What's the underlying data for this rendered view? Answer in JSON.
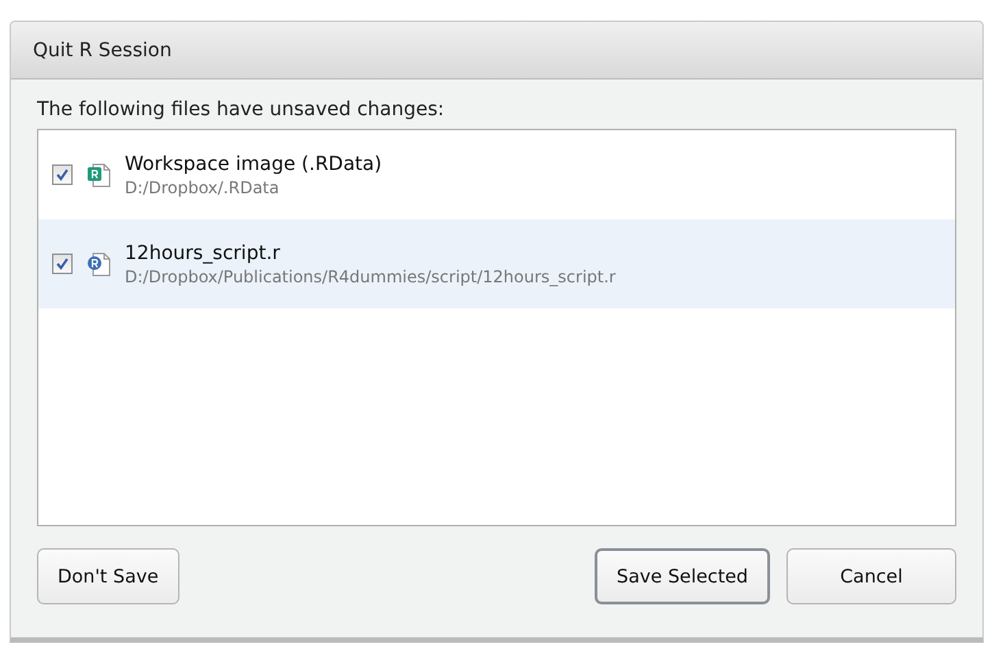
{
  "window": {
    "title": "Quit R Session"
  },
  "message": "The following files have unsaved changes:",
  "files": [
    {
      "kind": "workspace",
      "name": "Workspace image (.RData)",
      "path": "D:/Dropbox/.RData",
      "checked": true,
      "selected": false
    },
    {
      "kind": "script",
      "name": "12hours_script.r",
      "path": "D:/Dropbox/Publications/R4dummies/script/12hours_script.r",
      "checked": true,
      "selected": true
    }
  ],
  "buttons": [
    {
      "label": "Don't Save",
      "default": false
    },
    {
      "label": "Save Selected",
      "default": true
    },
    {
      "label": "Cancel",
      "default": false
    }
  ]
}
